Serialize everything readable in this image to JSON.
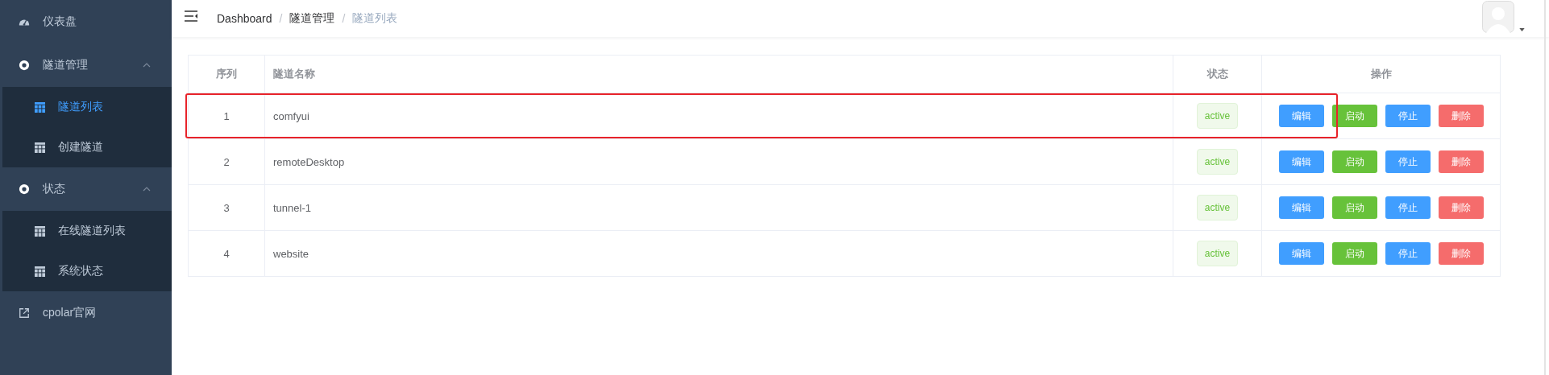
{
  "sidebar": {
    "items": [
      {
        "label": "仪表盘",
        "kind": "page",
        "selected": false
      },
      {
        "label": "隧道管理",
        "kind": "group",
        "expanded": true,
        "selected": false,
        "children": [
          {
            "label": "隧道列表",
            "selected": true
          },
          {
            "label": "创建隧道",
            "selected": false
          }
        ]
      },
      {
        "label": "状态",
        "kind": "group",
        "expanded": true,
        "selected": false,
        "children": [
          {
            "label": "在线隧道列表",
            "selected": false
          },
          {
            "label": "系统状态",
            "selected": false
          }
        ]
      },
      {
        "label": "cpolar官网",
        "kind": "link",
        "selected": false
      }
    ]
  },
  "breadcrumb": [
    {
      "label": "Dashboard"
    },
    {
      "separator": "/",
      "label": "隧道管理"
    },
    {
      "separator": "/",
      "label": "隧道列表"
    }
  ],
  "table": {
    "columns": [
      "序列",
      "隧道名称",
      "状态",
      "操作"
    ],
    "rows": [
      {
        "index": "1",
        "name": "comfyui",
        "status": "active",
        "highlighted": true,
        "actions": [
          {
            "label": "编辑",
            "kind": "primary"
          },
          {
            "label": "启动",
            "kind": "success"
          },
          {
            "label": "停止",
            "kind": "primary"
          },
          {
            "label": "删除",
            "kind": "danger"
          }
        ]
      },
      {
        "index": "2",
        "name": "remoteDesktop",
        "status": "active",
        "highlighted": false,
        "actions": [
          {
            "label": "编辑",
            "kind": "primary"
          },
          {
            "label": "启动",
            "kind": "success"
          },
          {
            "label": "停止",
            "kind": "primary"
          },
          {
            "label": "删除",
            "kind": "danger"
          }
        ]
      },
      {
        "index": "3",
        "name": "tunnel-1",
        "status": "active",
        "highlighted": false,
        "actions": [
          {
            "label": "编辑",
            "kind": "primary"
          },
          {
            "label": "启动",
            "kind": "success"
          },
          {
            "label": "停止",
            "kind": "primary"
          },
          {
            "label": "删除",
            "kind": "danger"
          }
        ]
      },
      {
        "index": "4",
        "name": "website",
        "status": "active",
        "highlighted": false,
        "actions": [
          {
            "label": "编辑",
            "kind": "primary"
          },
          {
            "label": "启动",
            "kind": "success"
          },
          {
            "label": "停止",
            "kind": "primary"
          },
          {
            "label": "删除",
            "kind": "danger"
          }
        ]
      }
    ]
  }
}
